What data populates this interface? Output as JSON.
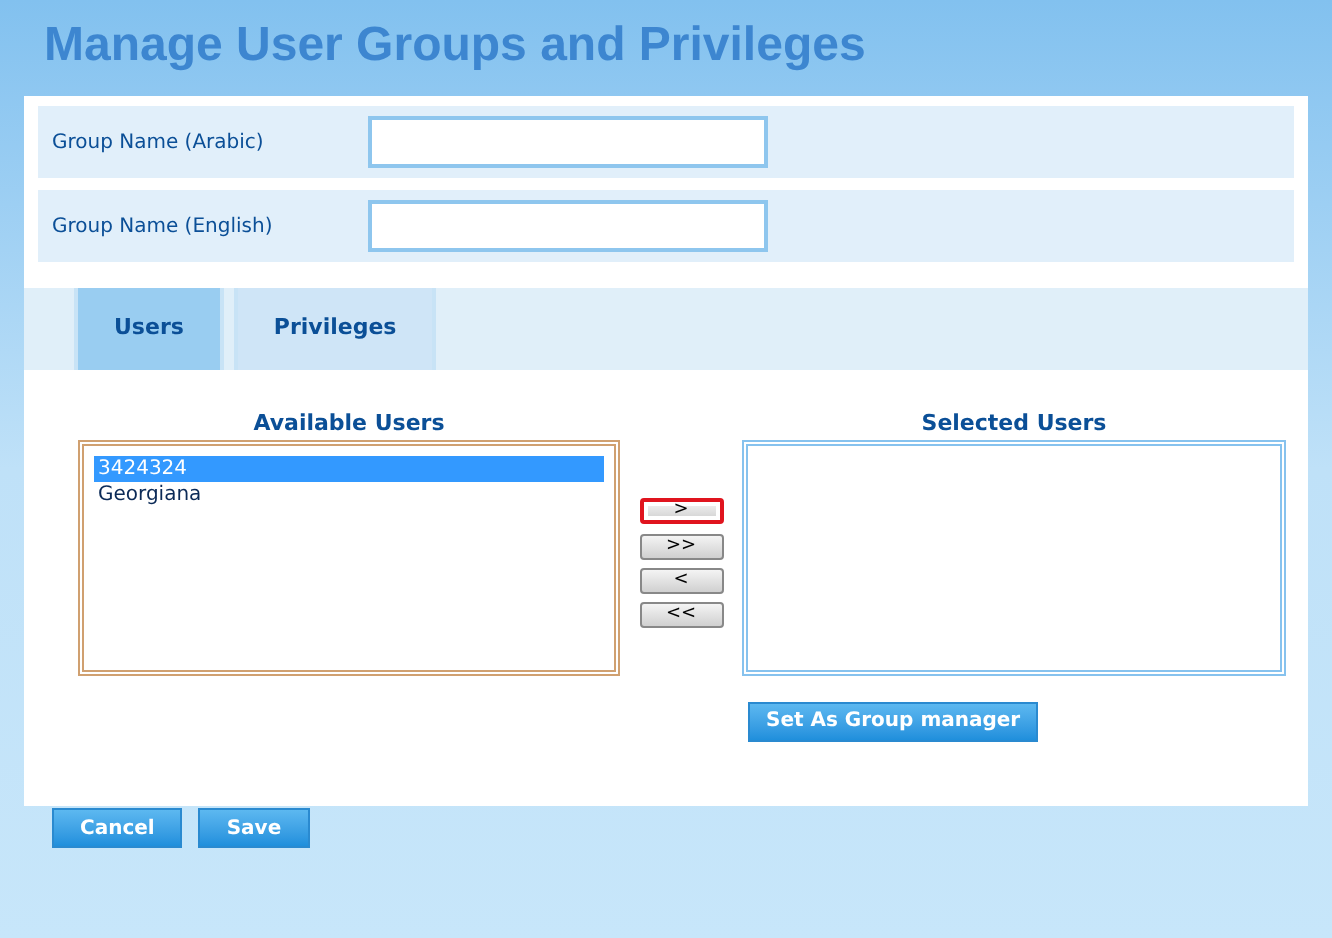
{
  "title": "Manage User Groups and Privileges",
  "fields": [
    {
      "label": "Group Name (Arabic)"
    },
    {
      "label": "Group Name (English)"
    }
  ],
  "tabs": [
    {
      "label": "Users",
      "selected": true
    },
    {
      "label": "Privileges",
      "selected": false
    }
  ],
  "available_users": {
    "heading": "Available Users",
    "items": [
      {
        "label": "3424324",
        "selected": true
      },
      {
        "label": "Georgiana",
        "selected": false
      }
    ]
  },
  "transfer_buttons": [
    {
      "label": ">",
      "highlighted": true
    },
    {
      "label": ">>",
      "highlighted": false
    },
    {
      "label": "<",
      "highlighted": false
    },
    {
      "label": "<<",
      "highlighted": false
    }
  ],
  "selected_users": {
    "heading": "Selected Users"
  },
  "set_manager_button": "Set As Group manager",
  "actions": [
    "Cancel",
    "Save"
  ]
}
